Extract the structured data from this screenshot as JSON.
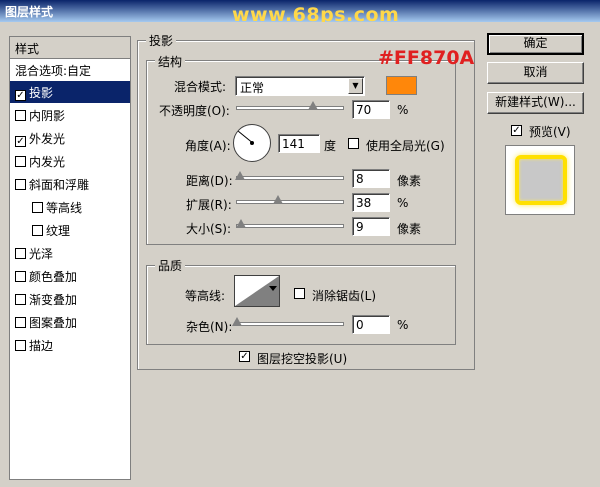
{
  "window": {
    "title": "图层样式",
    "watermark": "www.68ps.com"
  },
  "styles_list": {
    "header": "样式",
    "blend_options": "混合选项:自定",
    "items": [
      {
        "label": "投影",
        "checked": true,
        "selected": true
      },
      {
        "label": "内阴影",
        "checked": false
      },
      {
        "label": "外发光",
        "checked": true
      },
      {
        "label": "内发光",
        "checked": false
      },
      {
        "label": "斜面和浮雕",
        "checked": false
      },
      {
        "label": "等高线",
        "checked": false,
        "indent": true
      },
      {
        "label": "纹理",
        "checked": false,
        "indent": true
      },
      {
        "label": "光泽",
        "checked": false
      },
      {
        "label": "颜色叠加",
        "checked": false
      },
      {
        "label": "渐变叠加",
        "checked": false
      },
      {
        "label": "图案叠加",
        "checked": false
      },
      {
        "label": "描边",
        "checked": false
      }
    ]
  },
  "drop_shadow": {
    "title": "投影",
    "structure": {
      "title": "结构",
      "blend_mode_label": "混合模式:",
      "blend_mode_value": "正常",
      "color": "#ff870a",
      "color_annotation": "#FF870A",
      "opacity_label": "不透明度(O):",
      "opacity_value": "70",
      "opacity_unit": "%",
      "angle_label": "角度(A):",
      "angle_value": "141",
      "angle_unit": "度",
      "global_light_label": "使用全局光(G)",
      "global_light_checked": false,
      "distance_label": "距离(D):",
      "distance_value": "8",
      "distance_unit": "像素",
      "spread_label": "扩展(R):",
      "spread_value": "38",
      "spread_unit": "%",
      "size_label": "大小(S):",
      "size_value": "9",
      "size_unit": "像素"
    },
    "quality": {
      "title": "品质",
      "contour_label": "等高线:",
      "antialias_label": "消除锯齿(L)",
      "antialias_checked": false,
      "noise_label": "杂色(N):",
      "noise_value": "0",
      "noise_unit": "%"
    },
    "knockout_label": "图层挖空投影(U)",
    "knockout_checked": true
  },
  "buttons": {
    "ok": "确定",
    "cancel": "取消",
    "new_style": "新建样式(W)...",
    "preview_label": "预览(V)",
    "preview_checked": true
  },
  "sliders": {
    "opacity_fraction": 0.7,
    "distance_fraction": 0.03,
    "spread_fraction": 0.38,
    "size_fraction": 0.04,
    "noise_fraction": 0.0
  }
}
